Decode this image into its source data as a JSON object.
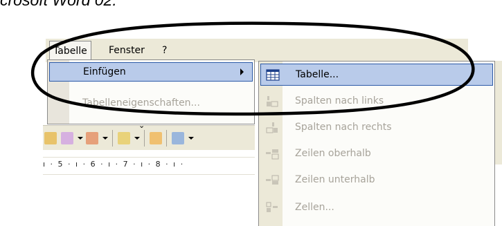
{
  "caption": "crosoft Word 02:",
  "menubar": {
    "items": [
      "Tabelle",
      "Fenster",
      "?"
    ]
  },
  "tabelle_menu": {
    "items": [
      {
        "label": "Einfügen",
        "state": "highlighted",
        "submenu": true
      },
      {
        "label": "Tabelleneigenschaften...",
        "state": "disabled"
      }
    ]
  },
  "einfuegen_submenu": {
    "items": [
      {
        "label": "Tabelle...",
        "icon": "table-icon",
        "state": "highlighted"
      },
      {
        "label": "Spalten nach links",
        "icon": "insert-column-left-icon",
        "state": "disabled"
      },
      {
        "label": "Spalten nach rechts",
        "icon": "insert-column-right-icon",
        "state": "disabled"
      },
      {
        "label": "Zeilen oberhalb",
        "icon": "insert-row-above-icon",
        "state": "disabled"
      },
      {
        "label": "Zeilen unterhalb",
        "icon": "insert-row-below-icon",
        "state": "disabled"
      },
      {
        "label": "Zellen...",
        "icon": "insert-cells-icon",
        "state": "disabled"
      }
    ]
  },
  "ruler": {
    "text": "ı · 5 · ı · 6 · ı · 7 · ı · 8 · ı ·"
  },
  "colors": {
    "menu_bg": "#ece9d8",
    "highlight": "#b9cbea",
    "highlight_border": "#2c5aa8",
    "disabled_text": "#a7a39a",
    "annotation_oval": "#000000"
  }
}
